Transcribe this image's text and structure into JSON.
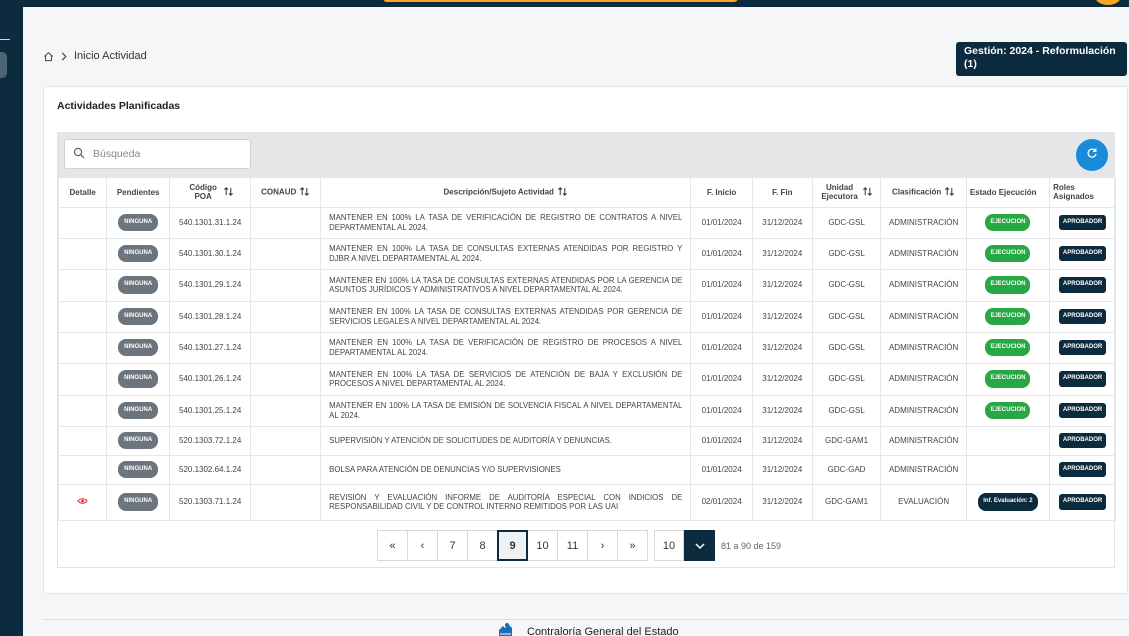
{
  "breadcrumb": {
    "current": "Inicio Actividad"
  },
  "gestion": {
    "label": "Gestión: 2024 - Reformulación (1)"
  },
  "card": {
    "title": "Actividades Planificadas"
  },
  "search": {
    "placeholder": "Búsqueda"
  },
  "table": {
    "headers": {
      "detalle": "Detalle",
      "pendientes": "Pendientes",
      "codigo": "Código POA",
      "conaud": "CONAUD",
      "descripcion": "Descripción/Sujeto Actividad",
      "inicio": "F. Inicio",
      "fin": "F. Fin",
      "unidad": "Unidad Ejecutora",
      "clasificacion": "Clasificación",
      "estado": "Estado Ejecución",
      "roles": "Roles Asignados"
    },
    "rows": [
      {
        "pend": "NINGUNA",
        "codigo": "540.1301.31.1.24",
        "conaud": "",
        "desc": "MANTENER EN 100% LA TASA DE VERIFICACIÓN DE REGISTRO DE CONTRATOS A NIVEL DEPARTAMENTAL AL 2024.",
        "inicio": "01/01/2024",
        "fin": "31/12/2024",
        "unidad": "GDC-GSL",
        "clasif": "ADMINISTRACIÓN",
        "estado": "EJECUCION",
        "rol": "APROBADOR"
      },
      {
        "pend": "NINGUNA",
        "codigo": "540.1301.30.1.24",
        "conaud": "",
        "desc": "MANTENER EN 100% LA TASA DE CONSULTAS EXTERNAS ATENDIDAS POR REGISTRO Y DJBR A NIVEL DEPARTAMENTAL AL 2024.",
        "inicio": "01/01/2024",
        "fin": "31/12/2024",
        "unidad": "GDC-GSL",
        "clasif": "ADMINISTRACIÓN",
        "estado": "EJECUCION",
        "rol": "APROBADOR"
      },
      {
        "pend": "NINGUNA",
        "codigo": "540.1301.29.1.24",
        "conaud": "",
        "desc": "MANTENER EN 100% LA TASA DE CONSULTAS EXTERNAS ATENDIDAS POR LA GERENCIA DE ASUNTOS JURÍDICOS Y ADMINISTRATIVOS A NIVEL DEPARTAMENTAL AL 2024.",
        "inicio": "01/01/2024",
        "fin": "31/12/2024",
        "unidad": "GDC-GSL",
        "clasif": "ADMINISTRACIÓN",
        "estado": "EJECUCION",
        "rol": "APROBADOR"
      },
      {
        "pend": "NINGUNA",
        "codigo": "540.1301.28.1.24",
        "conaud": "",
        "desc": "MANTENER EN 100% LA TASA DE CONSULTAS EXTERNAS ATENDIDAS POR GERENCIA DE SERVICIOS LEGALES A NIVEL DEPARTAMENTAL AL 2024.",
        "inicio": "01/01/2024",
        "fin": "31/12/2024",
        "unidad": "GDC-GSL",
        "clasif": "ADMINISTRACIÓN",
        "estado": "EJECUCION",
        "rol": "APROBADOR"
      },
      {
        "pend": "NINGUNA",
        "codigo": "540.1301.27.1.24",
        "conaud": "",
        "desc": "MANTENER EN 100% LA TASA DE VERIFICACIÓN DE REGISTRO DE PROCESOS A NIVEL DEPARTAMENTAL AL 2024.",
        "inicio": "01/01/2024",
        "fin": "31/12/2024",
        "unidad": "GDC-GSL",
        "clasif": "ADMINISTRACIÓN",
        "estado": "EJECUCION",
        "rol": "APROBADOR"
      },
      {
        "pend": "NINGUNA",
        "codigo": "540.1301.26.1.24",
        "conaud": "",
        "desc": "MANTENER EN 100% LA TASA DE SERVICIOS DE ATENCIÓN DE BAJA Y EXCLUSIÓN DE PROCESOS A NIVEL DEPARTAMENTAL AL 2024.",
        "inicio": "01/01/2024",
        "fin": "31/12/2024",
        "unidad": "GDC-GSL",
        "clasif": "ADMINISTRACIÓN",
        "estado": "EJECUCION",
        "rol": "APROBADOR"
      },
      {
        "pend": "NINGUNA",
        "codigo": "540.1301.25.1.24",
        "conaud": "",
        "desc": "MANTENER EN 100% LA TASA DE EMISIÓN DE SOLVENCIA FISCAL A NIVEL DEPARTAMENTAL AL 2024.",
        "inicio": "01/01/2024",
        "fin": "31/12/2024",
        "unidad": "GDC-GSL",
        "clasif": "ADMINISTRACIÓN",
        "estado": "EJECUCION",
        "rol": "APROBADOR"
      },
      {
        "pend": "NINGUNA",
        "codigo": "520.1303.72.1.24",
        "conaud": "",
        "desc": "SUPERVISIÓN Y ATENCIÓN DE SOLICITUDES DE AUDITORÍA Y DENUNCIAS.",
        "inicio": "01/01/2024",
        "fin": "31/12/2024",
        "unidad": "GDC-GAM1",
        "clasif": "ADMINISTRACIÓN",
        "estado": "",
        "rol": "APROBADOR"
      },
      {
        "pend": "NINGUNA",
        "codigo": "520.1302.64.1.24",
        "conaud": "",
        "desc": "BOLSA PARA ATENCIÓN DE DENUNCIAS Y/O SUPERVISIONES",
        "inicio": "01/01/2024",
        "fin": "31/12/2024",
        "unidad": "GDC-GAD",
        "clasif": "ADMINISTRACIÓN",
        "estado": "",
        "rol": "APROBADOR"
      },
      {
        "pend": "NINGUNA",
        "codigo": "520.1303.71.1.24",
        "conaud": "",
        "desc": "REVISIÓN Y EVALUACIÓN INFORME DE AUDITORÍA ESPECIAL CON INDICIOS DE RESPONSABILIDAD CIVIL Y DE CONTROL INTERNO REMITIDOS POR LAS UAI",
        "inicio": "02/01/2024",
        "fin": "31/12/2024",
        "unidad": "GDC-GAM1",
        "clasif": "EVALUACIÓN",
        "estado": "Inf. Evaluación: 2",
        "rol": "APROBADOR",
        "detalle_icon": "eye-icon"
      }
    ]
  },
  "pagination": {
    "first": "«",
    "prev": "‹",
    "pages": [
      "7",
      "8",
      "9",
      "10",
      "11"
    ],
    "active": "9",
    "next": "›",
    "last": "»",
    "per_page": "10",
    "info": "81 a 90 de 159"
  },
  "footer": {
    "text": "Contraloría General del Estado"
  },
  "colors": {
    "navy": "#0d2b3e",
    "accent": "#f5a623",
    "success": "#28a745",
    "primary": "#1a8ad9"
  }
}
